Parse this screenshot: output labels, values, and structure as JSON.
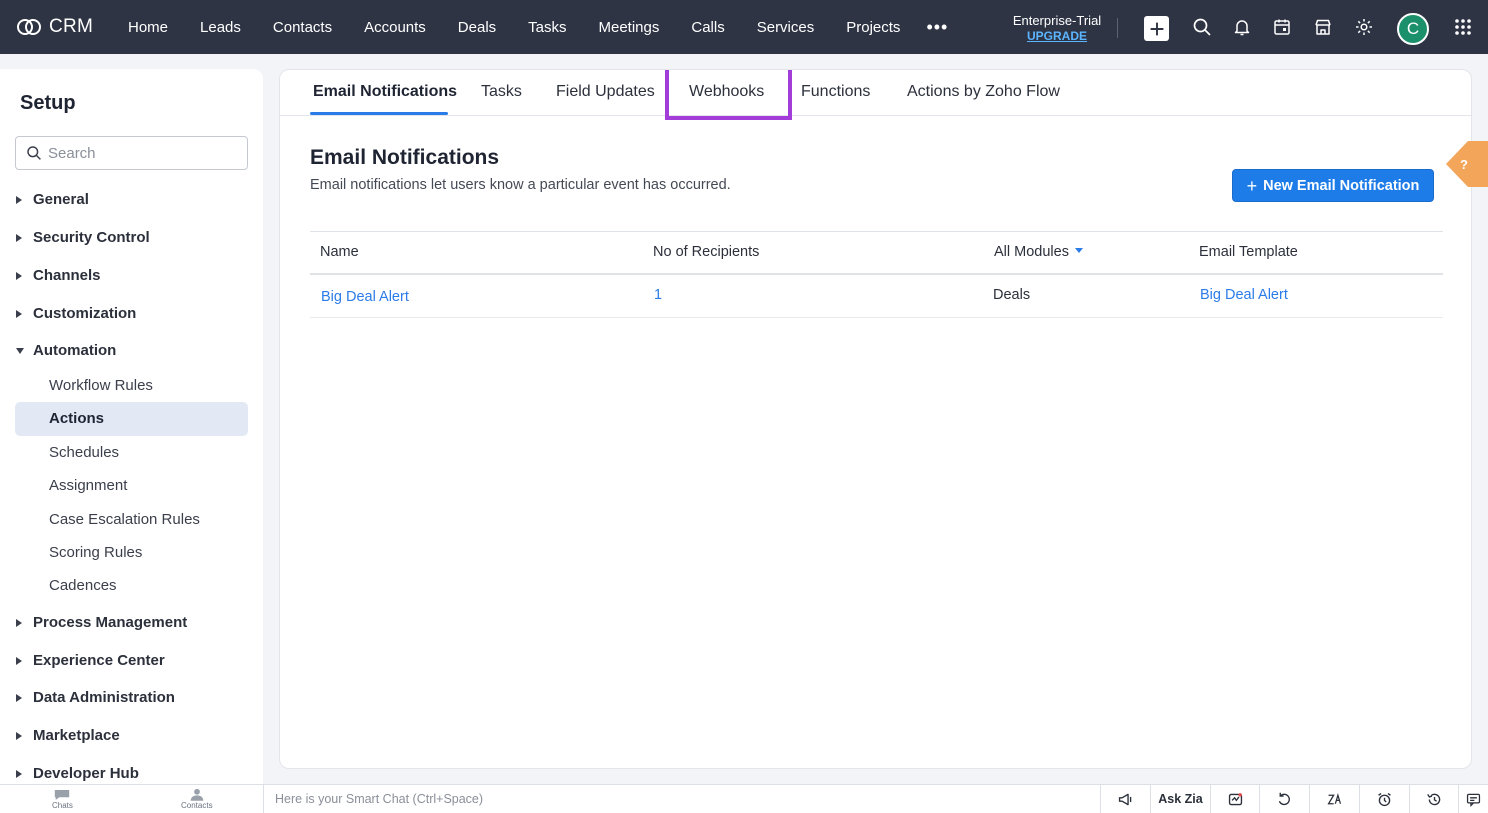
{
  "topbar": {
    "app_name": "CRM",
    "nav": [
      "Home",
      "Leads",
      "Contacts",
      "Accounts",
      "Deals",
      "Tasks",
      "Meetings",
      "Calls",
      "Services",
      "Projects"
    ],
    "more": "•••",
    "edition": "Enterprise-Trial",
    "upgrade": "UPGRADE",
    "avatar_initial": "C"
  },
  "sidebar": {
    "title": "Setup",
    "search_placeholder": "Search",
    "sections_top": [
      "General",
      "Security Control",
      "Channels",
      "Customization"
    ],
    "expanded_section": "Automation",
    "automation_items": [
      "Workflow Rules",
      "Actions",
      "Schedules",
      "Assignment",
      "Case Escalation Rules",
      "Scoring Rules",
      "Cadences"
    ],
    "active_item": "Actions",
    "sections_bottom": [
      "Process Management",
      "Experience Center",
      "Data Administration",
      "Marketplace",
      "Developer Hub"
    ]
  },
  "main": {
    "tabs": [
      "Email Notifications",
      "Tasks",
      "Field Updates",
      "Webhooks",
      "Functions",
      "Actions by Zoho Flow"
    ],
    "active_tab": "Email Notifications",
    "highlighted_tab": "Webhooks",
    "heading": "Email Notifications",
    "description": "Email notifications let users know a particular event has occurred.",
    "new_button": "New Email Notification",
    "table": {
      "columns": [
        "Name",
        "No of Recipients",
        "All Modules",
        "Email Template"
      ],
      "rows": [
        {
          "name": "Big Deal Alert",
          "recipients": "1",
          "module": "Deals",
          "template": "Big Deal Alert"
        }
      ]
    }
  },
  "help_label": "?",
  "bottombar": {
    "chats": "Chats",
    "contacts": "Contacts",
    "smart_chat_placeholder": "Here is your Smart Chat (Ctrl+Space)",
    "ask_zia": "Ask Zia"
  },
  "colors": {
    "topbar": "#2e3444",
    "accent": "#2b7ce8",
    "highlight_box": "#a23dd9",
    "avatar": "#1c8f6b",
    "help_tab": "#f3a55a"
  }
}
